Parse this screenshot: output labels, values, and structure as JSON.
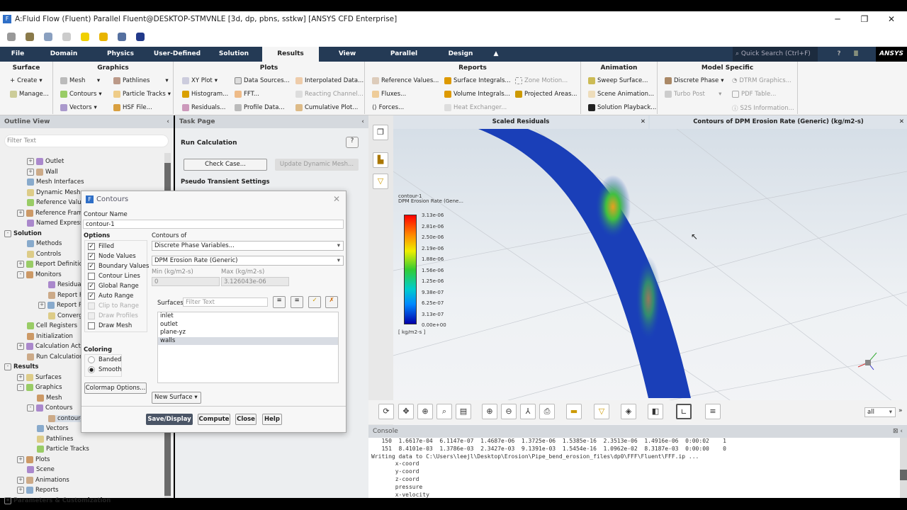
{
  "window": {
    "title": "A:Fluid Flow (Fluent) Parallel Fluent@DESKTOP-STMVNLE  [3d, dp, pbns, sstkw] [ANSYS CFD Enterprise]",
    "minimize": "─",
    "restore": "❐",
    "close": "✕"
  },
  "menu": {
    "tabs": [
      "File",
      "Domain",
      "Physics",
      "User-Defined",
      "Solution",
      "Results",
      "View",
      "Parallel",
      "Design"
    ],
    "active": "Results",
    "search_placeholder": "Quick Search (Ctrl+F)",
    "brand": "ANSYS"
  },
  "ribbon": {
    "surface": {
      "title": "Surface",
      "items": [
        "Create",
        "Manage..."
      ]
    },
    "graphics": {
      "title": "Graphics",
      "items": [
        "Mesh",
        "Contours",
        "Vectors",
        "Pathlines",
        "Particle Tracks",
        "HSF File..."
      ]
    },
    "plots": {
      "title": "Plots",
      "items": [
        "XY Plot",
        "Histogram...",
        "Residuals...",
        "Data Sources...",
        "FFT...",
        "Profile Data...",
        "Interpolated Data...",
        "Reacting Channel...",
        "Cumulative Plot..."
      ]
    },
    "reports": {
      "title": "Reports",
      "items": [
        "Reference Values...",
        "Fluxes...",
        "Forces...",
        "Surface Integrals...",
        "Volume Integrals...",
        "Heat Exchanger...",
        "Zone Motion...",
        "Projected Areas..."
      ]
    },
    "animation": {
      "title": "Animation",
      "items": [
        "Sweep Surface...",
        "Scene Animation...",
        "Solution Playback..."
      ]
    },
    "model": {
      "title": "Model Specific",
      "items": [
        "Discrete Phase",
        "Turbo Post",
        "DTRM Graphics...",
        "PDF Table...",
        "S2S Information..."
      ]
    }
  },
  "outline": {
    "title": "Outline View",
    "filter_placeholder": "Filter Text",
    "items": [
      "Outlet",
      "Wall",
      "Mesh Interfaces",
      "Dynamic Mesh",
      "Reference Values",
      "Reference Frames",
      "Named Expressions",
      "Solution",
      "Methods",
      "Controls",
      "Report Definitions",
      "Monitors",
      "Residual",
      "Report Files",
      "Report Plots",
      "Convergence",
      "Cell Registers",
      "Initialization",
      "Calculation Activities",
      "Run Calculation",
      "Results",
      "Surfaces",
      "Graphics",
      "Mesh",
      "Contours",
      "contour-1",
      "Vectors",
      "Pathlines",
      "Particle Tracks",
      "Plots",
      "Scene",
      "Animations",
      "Reports",
      "Parameters & Customization"
    ]
  },
  "task": {
    "title": "Task Page",
    "heading": "Run Calculation",
    "check_case": "Check Case...",
    "update_mesh": "Update Dynamic Mesh...",
    "pseudo": "Pseudo Transient Settings"
  },
  "dialog": {
    "title": "Contours",
    "name_label": "Contour Name",
    "name_value": "contour-1",
    "options_label": "Options",
    "options": [
      {
        "label": "Filled",
        "checked": true
      },
      {
        "label": "Node Values",
        "checked": true
      },
      {
        "label": "Boundary Values",
        "checked": true
      },
      {
        "label": "Contour Lines",
        "checked": false
      },
      {
        "label": "Global Range",
        "checked": true
      },
      {
        "label": "Auto Range",
        "checked": true
      },
      {
        "label": "Clip to Range",
        "checked": false
      },
      {
        "label": "Draw Profiles",
        "checked": false
      },
      {
        "label": "Draw Mesh",
        "checked": false
      }
    ],
    "contours_of_label": "Contours of",
    "category": "Discrete Phase Variables...",
    "variable": "DPM Erosion Rate (Generic)",
    "min_label": "Min (kg/m2-s)",
    "max_label": "Max (kg/m2-s)",
    "min_value": "0",
    "max_value": "3.126043e-06",
    "surfaces_label": "Surfaces",
    "surfaces_filter": "Filter Text",
    "surfaces": [
      "inlet",
      "outlet",
      "plane-yz",
      "walls"
    ],
    "selected_surface": "walls",
    "coloring_label": "Coloring",
    "banded": "Banded",
    "smooth": "Smooth",
    "colormap_btn": "Colormap Options...",
    "new_surface": "New Surface",
    "save_display": "Save/Display",
    "compute": "Compute",
    "close": "Close",
    "help": "Help"
  },
  "viewports": {
    "left_title": "Scaled Residuals",
    "right_title": "Contours of DPM Erosion Rate (Generic) (kg/m2-s)"
  },
  "legend": {
    "name": "contour-1",
    "var": "DPM Erosion Rate (Gene...",
    "ticks": [
      "3.13e-06",
      "2.81e-06",
      "2.50e-06",
      "2.19e-06",
      "1.88e-06",
      "1.56e-06",
      "1.25e-06",
      "9.38e-07",
      "6.25e-07",
      "3.13e-07",
      "0.00e+00"
    ],
    "units": "[ kg/m2-s ]"
  },
  "view_select": "all",
  "console": {
    "title": "Console",
    "lines": [
      "   150  1.6617e-04  6.1147e-07  1.4687e-06  1.3725e-06  1.5385e-16  2.3513e-06  1.4916e-06  0:00:02    1",
      "   151  8.4101e-03  1.3786e-03  2.3427e-03  9.1391e-03  1.5454e-16  1.0962e-02  8.3187e-03  0:00:00    0",
      "Writing data to C:\\Users\\leejl\\Desktop\\Erosion\\Pipe_bend_erosion_files\\dp0\\FFF\\Fluent\\FFF.ip ...",
      "       x-coord",
      "       y-coord",
      "       z-coord",
      "       pressure",
      "       x-velocity"
    ]
  }
}
